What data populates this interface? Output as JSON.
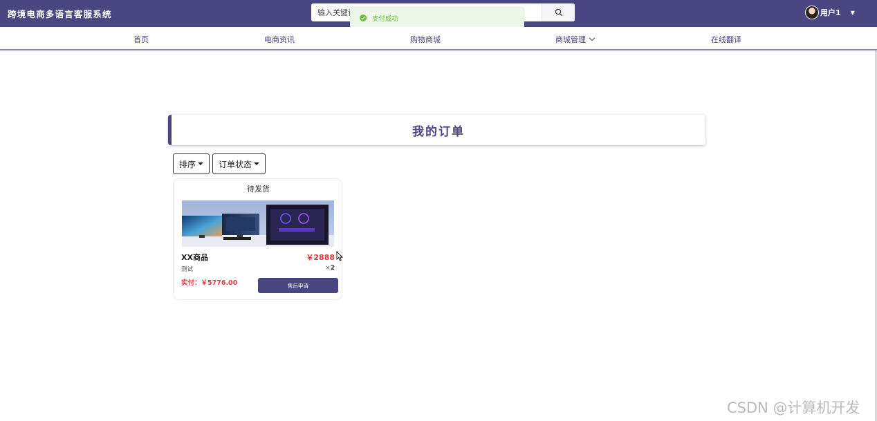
{
  "header": {
    "site_title": "跨境电商多语言客服系统",
    "search_placeholder": "输入关键词",
    "user_name": "用户1",
    "colors": {
      "primary": "#4a4682"
    }
  },
  "toast": {
    "text": "支付成功",
    "icon": "check-circle-icon",
    "color": "#67c23a"
  },
  "nav": {
    "items": [
      {
        "label": "首页"
      },
      {
        "label": "电商资讯"
      },
      {
        "label": "购物商城"
      },
      {
        "label": "商城管理",
        "has_dropdown": true
      },
      {
        "label": "在线翻译"
      }
    ]
  },
  "main": {
    "title": "我的订单",
    "filters": {
      "sort_label": "排序",
      "status_label": "订单状态"
    },
    "orders": [
      {
        "status": "待发货",
        "name": "XX商品",
        "price": "￥2888",
        "description": "测试",
        "quantity": "2",
        "paid": "实付：￥5776.00",
        "action_label": "售后申请"
      }
    ]
  },
  "watermark": "CSDN @计算机开发"
}
